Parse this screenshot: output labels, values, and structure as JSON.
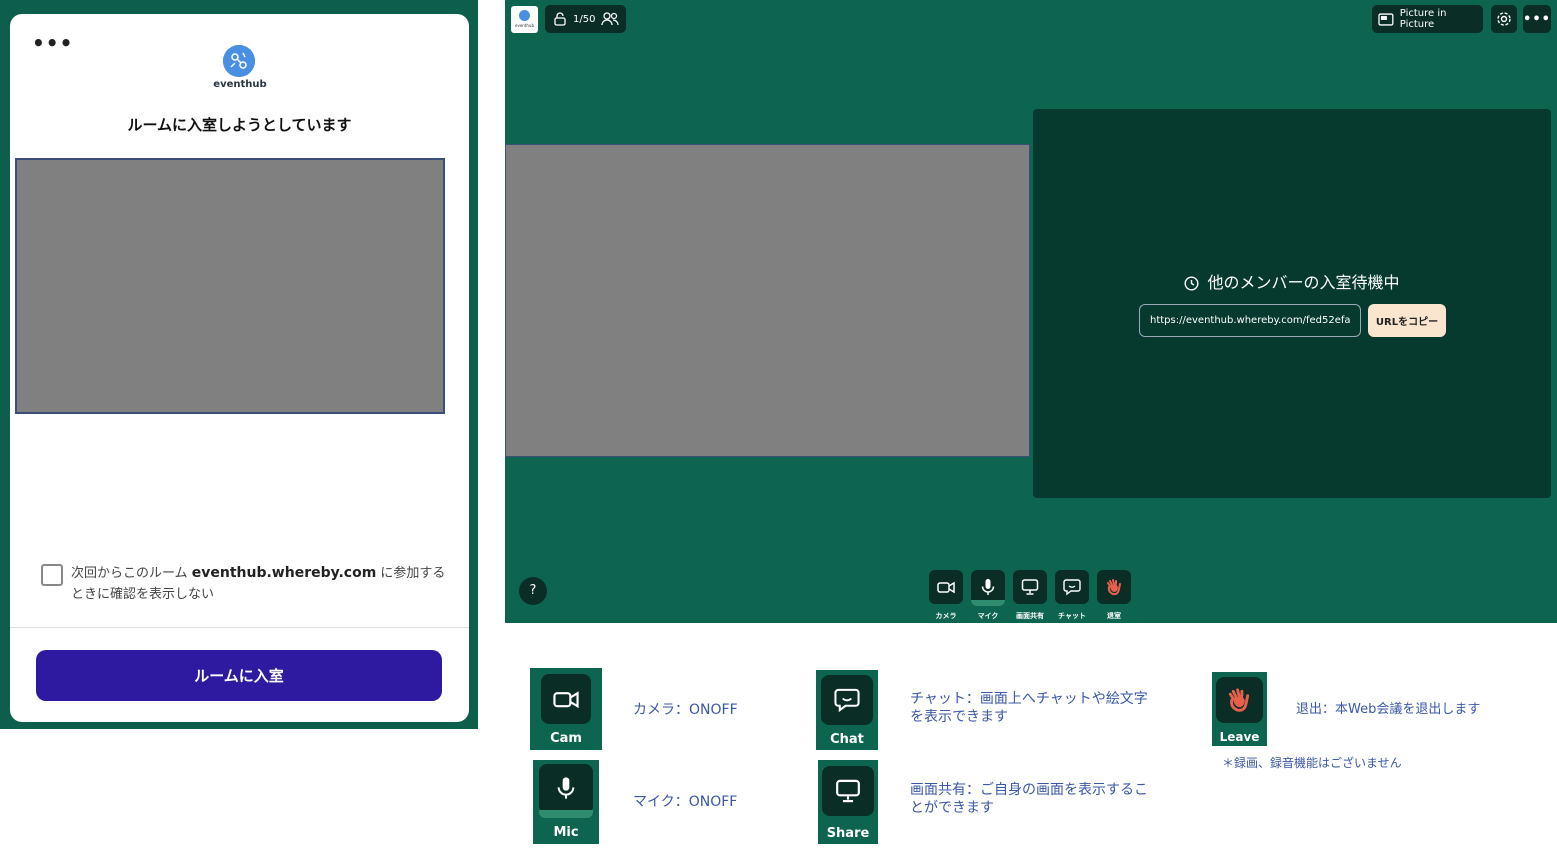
{
  "join_dialog": {
    "menu_dots": "•••",
    "logo_text": "eventhub",
    "title": "ルームに入室しようとしています",
    "checkbox_prefix": "次回からこのルーム ",
    "checkbox_domain": "eventhub.whereby.com",
    "checkbox_suffix": " に参加するときに確認を表示しない",
    "join_button": "ルームに入室"
  },
  "room": {
    "logo_text": "eventhub",
    "participant_count": "1/50",
    "pip_label": "Picture in Picture",
    "more_label": "•••",
    "waiting_message": "他のメンバーの入室待機中",
    "url_value": "https://eventhub.whereby.com/fed52efa-",
    "copy_button": "URLをコピー",
    "help_label": "?",
    "toolbar": {
      "camera": "カメラ",
      "mic": "マイク",
      "share": "画面共有",
      "chat": "チャット",
      "leave": "退室"
    }
  },
  "legend": {
    "cam_label": "Cam",
    "cam_desc": "カメラ：ONOFF",
    "mic_label": "Mic",
    "mic_desc": "マイク：ONOFF",
    "chat_label": "Chat",
    "chat_desc": "チャット：画面上へチャットや絵文字を表示できます",
    "share_label": "Share",
    "share_desc": "画面共有：ご自身の画面を表示することができます",
    "leave_label": "Leave",
    "leave_desc": "退出：本Web会議を退出します",
    "note": "＊録画、録音機能はございません"
  },
  "colors": {
    "frame_green": "#0d5e4b",
    "room_green": "#0d654f",
    "dark_panel": "#063a2e",
    "join_purple": "#2d1aa0",
    "copy_cream": "#fae6cf",
    "legend_blue": "#3a57a8",
    "leave_red": "#e8604c"
  }
}
